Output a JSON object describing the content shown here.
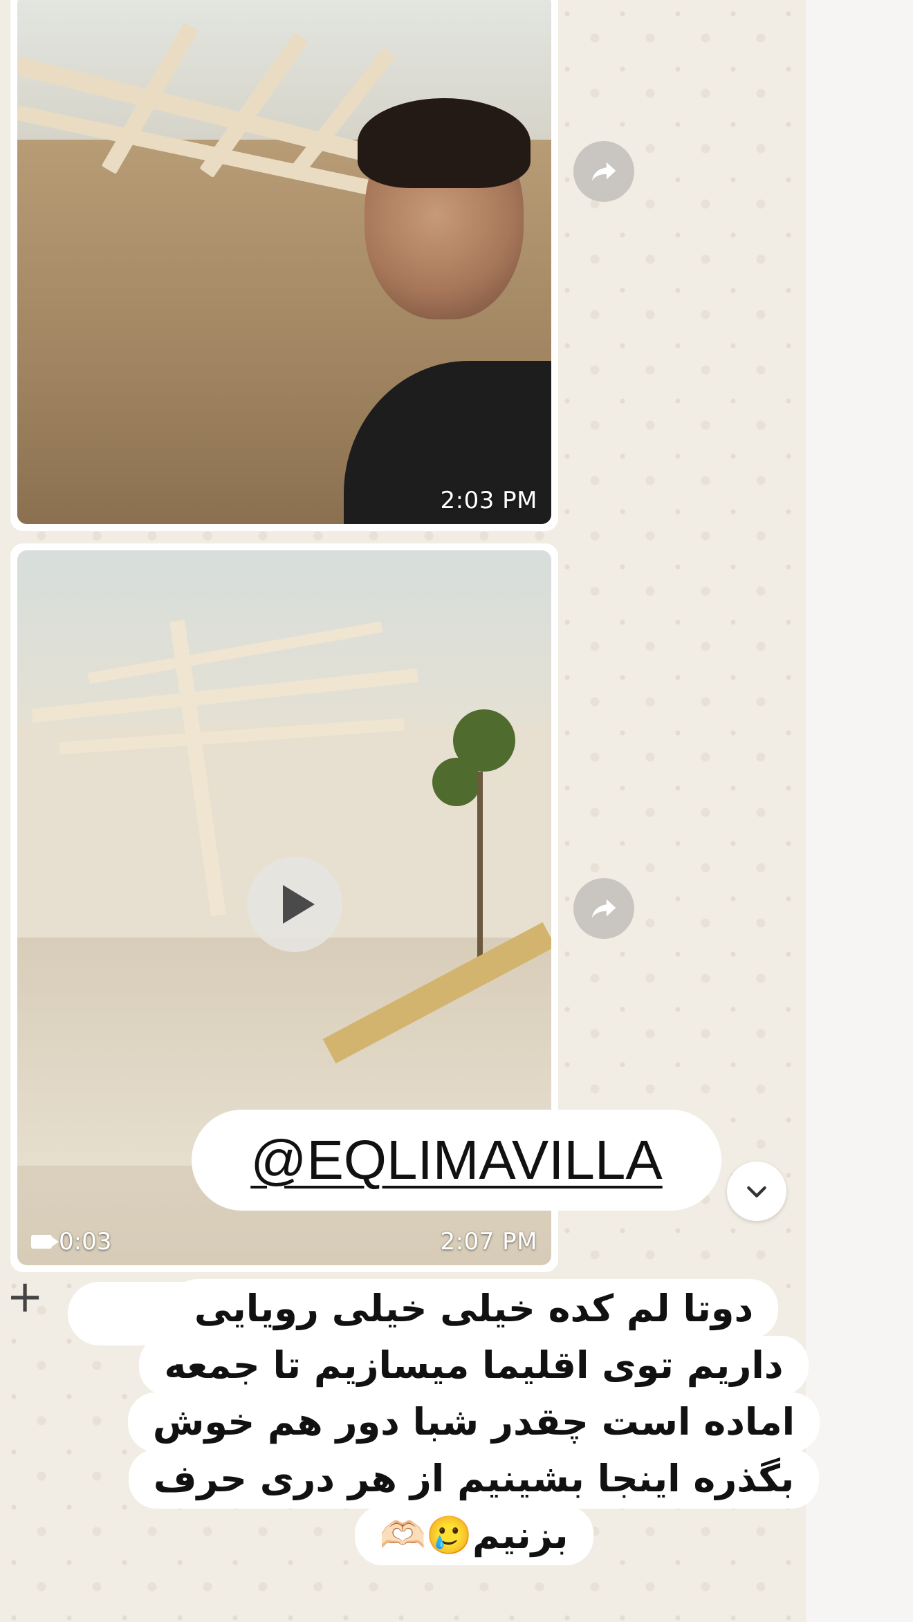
{
  "chat": {
    "messages": [
      {
        "type": "photo",
        "time": "2:03 PM"
      },
      {
        "type": "video",
        "time": "2:07 PM",
        "duration": "0:03"
      }
    ]
  },
  "sticker_tag": {
    "text": "@EQLIMAVILLA"
  },
  "caption_sticker": {
    "lines": [
      "دوتا  لم کده خیلی خیلی رویایی",
      "داریم توی اقلیما میسازیم تا جمعه",
      "اماده است چقدر شبا دور هم خوش",
      "بگذره اینجا بشینیم از هر دری حرف",
      "بزنیم🥲🫶🏻"
    ]
  },
  "icons": {
    "forward": "forward-arrow-icon",
    "play": "play-icon",
    "video_camera": "video-camera-icon",
    "scroll_down": "chevron-down-icon",
    "attach": "plus-icon"
  },
  "colors": {
    "wallpaper": "#efeae2",
    "bubble": "#ffffff",
    "forward_button": "#c9c6c1"
  }
}
